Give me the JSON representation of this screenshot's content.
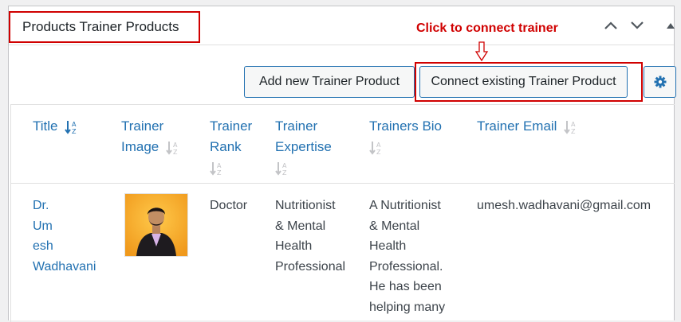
{
  "panel": {
    "title": "Products Trainer Products",
    "controls": [
      "chevron-up-icon",
      "chevron-down-icon",
      "triangle-up-icon"
    ]
  },
  "callout": {
    "text": "Click to connect trainer"
  },
  "toolbar": {
    "add_label": "Add new Trainer Product",
    "connect_label": "Connect existing Trainer Product",
    "settings_icon": "gear-icon"
  },
  "table": {
    "columns": [
      {
        "line1": "Title",
        "line2": "",
        "line3": ""
      },
      {
        "line1": "Trainer",
        "line2": "Image",
        "line3": ""
      },
      {
        "line1": "Trainer",
        "line2": "Rank",
        "line3": ""
      },
      {
        "line1": "Trainer",
        "line2": "Expertise",
        "line3": ""
      },
      {
        "line1": "Trainers Bio",
        "line2": "",
        "line3": ""
      },
      {
        "line1": "Trainer Email",
        "line2": "",
        "line3": ""
      }
    ],
    "rows": [
      {
        "title_lines": [
          "Dr.",
          "Um",
          "esh",
          "Wadhavani"
        ],
        "image_icon": "trainer-photo",
        "rank": "Doctor",
        "expertise_lines": [
          "Nutritionist",
          "& Mental",
          "Health",
          "Professional"
        ],
        "bio_lines": [
          "A Nutritionist",
          "& Mental",
          "Health",
          "Professional.",
          "He has been",
          "helping many"
        ],
        "email": "umesh.wadhavani@gmail.com"
      }
    ]
  },
  "colors": {
    "accent": "#2271b1",
    "highlight": "#d00000",
    "photo_bg": "#f5a623"
  }
}
